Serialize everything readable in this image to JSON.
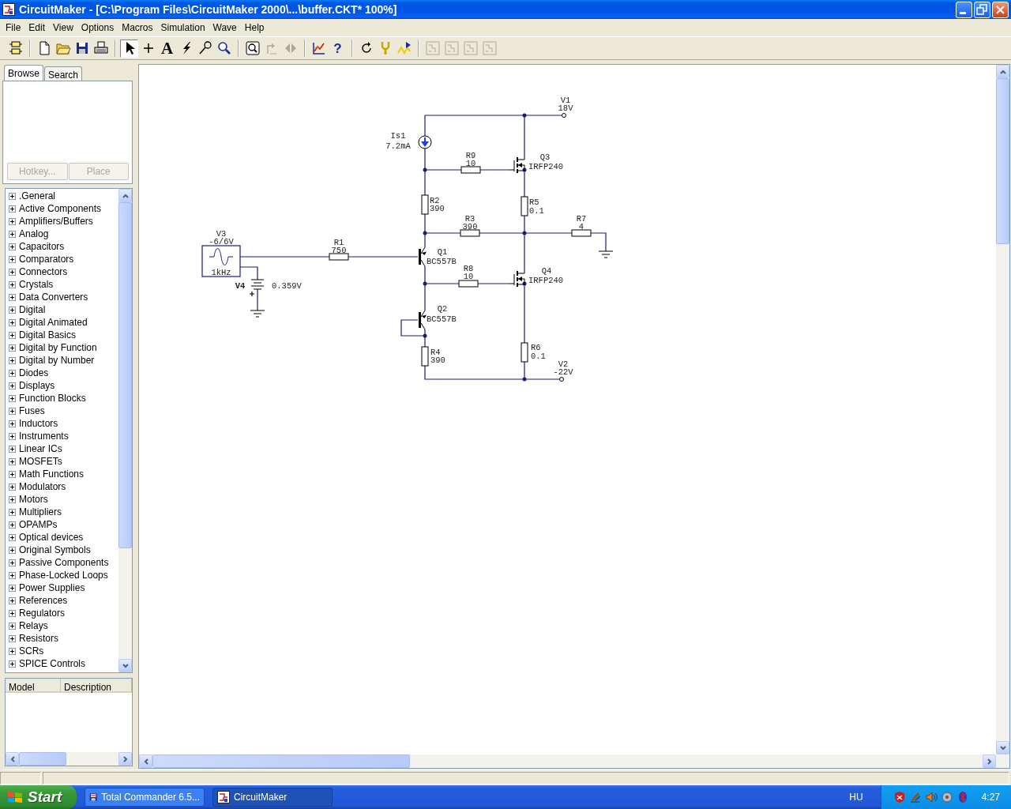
{
  "window": {
    "title": "CircuitMaker - [C:\\Program Files\\CircuitMaker 2000\\...\\buffer.CKT* 100%]"
  },
  "menu": [
    "File",
    "Edit",
    "View",
    "Options",
    "Macros",
    "Simulation",
    "Wave",
    "Help"
  ],
  "toolbar": [
    [
      {
        "kind": "component",
        "selected": false,
        "disabled": false
      }
    ],
    [
      {
        "kind": "new",
        "selected": false,
        "disabled": false
      },
      {
        "kind": "open",
        "selected": false,
        "disabled": false
      },
      {
        "kind": "save",
        "selected": false,
        "disabled": false
      },
      {
        "kind": "print",
        "selected": false,
        "disabled": false
      }
    ],
    [
      {
        "kind": "pointer",
        "selected": true,
        "disabled": false
      },
      {
        "kind": "wire",
        "selected": false,
        "disabled": false
      },
      {
        "kind": "text",
        "label": "A",
        "selected": false,
        "disabled": false
      },
      {
        "kind": "bolt",
        "selected": false,
        "disabled": false
      },
      {
        "kind": "probe",
        "selected": false,
        "disabled": false
      },
      {
        "kind": "zoom",
        "selected": false,
        "disabled": false
      }
    ],
    [
      {
        "kind": "zoom-window",
        "selected": false,
        "disabled": false
      },
      {
        "kind": "rotate",
        "selected": false,
        "disabled": true
      },
      {
        "kind": "mirror",
        "selected": false,
        "disabled": true
      }
    ],
    [
      {
        "kind": "analysis",
        "selected": false,
        "disabled": false
      },
      {
        "kind": "help",
        "label": "?",
        "selected": false,
        "disabled": false
      }
    ],
    [
      {
        "kind": "undo",
        "selected": false,
        "disabled": false
      },
      {
        "kind": "wrench",
        "selected": false,
        "disabled": false
      },
      {
        "kind": "wave",
        "selected": false,
        "disabled": false
      }
    ],
    [
      {
        "kind": "layout",
        "selected": false,
        "disabled": true
      },
      {
        "kind": "layout",
        "selected": false,
        "disabled": true
      },
      {
        "kind": "layout",
        "selected": false,
        "disabled": true
      },
      {
        "kind": "layout",
        "selected": false,
        "disabled": true
      }
    ]
  ],
  "library_panel": {
    "tabs": [
      {
        "label": "Browse",
        "selected": true
      },
      {
        "label": "Search",
        "selected": false
      }
    ],
    "buttons": [
      {
        "label": "Hotkey...",
        "disabled": true
      },
      {
        "label": "Place",
        "disabled": true
      }
    ],
    "categories": [
      {
        "label": ".General",
        "expanded": false
      },
      {
        "label": "Active Components",
        "expanded": false
      },
      {
        "label": "Amplifiers/Buffers",
        "expanded": false
      },
      {
        "label": "Analog",
        "expanded": false
      },
      {
        "label": "Capacitors",
        "expanded": false
      },
      {
        "label": "Comparators",
        "expanded": false
      },
      {
        "label": "Connectors",
        "expanded": false
      },
      {
        "label": "Crystals",
        "expanded": false
      },
      {
        "label": "Data Converters",
        "expanded": false
      },
      {
        "label": "Digital",
        "expanded": false
      },
      {
        "label": "Digital Animated",
        "expanded": false
      },
      {
        "label": "Digital Basics",
        "expanded": false
      },
      {
        "label": "Digital by Function",
        "expanded": false
      },
      {
        "label": "Digital by Number",
        "expanded": false
      },
      {
        "label": "Diodes",
        "expanded": false
      },
      {
        "label": "Displays",
        "expanded": false
      },
      {
        "label": "Function Blocks",
        "expanded": false
      },
      {
        "label": "Fuses",
        "expanded": false
      },
      {
        "label": "Inductors",
        "expanded": false
      },
      {
        "label": "Instruments",
        "expanded": false
      },
      {
        "label": "Linear ICs",
        "expanded": false
      },
      {
        "label": "MOSFETs",
        "expanded": false
      },
      {
        "label": "Math Functions",
        "expanded": false
      },
      {
        "label": "Modulators",
        "expanded": false
      },
      {
        "label": "Motors",
        "expanded": false
      },
      {
        "label": "Multipliers",
        "expanded": false
      },
      {
        "label": "OPAMPs",
        "expanded": false
      },
      {
        "label": "Optical devices",
        "expanded": false
      },
      {
        "label": "Original Symbols",
        "expanded": false
      },
      {
        "label": "Passive Components",
        "expanded": false
      },
      {
        "label": "Phase-Locked Loops",
        "expanded": false
      },
      {
        "label": "Power Supplies",
        "expanded": false
      },
      {
        "label": "References",
        "expanded": false
      },
      {
        "label": "Regulators",
        "expanded": false
      },
      {
        "label": "Relays",
        "expanded": false
      },
      {
        "label": "Resistors",
        "expanded": false
      },
      {
        "label": "SCRs",
        "expanded": false
      },
      {
        "label": "SPICE Controls",
        "expanded": false
      }
    ],
    "columns": [
      "Model",
      "Description"
    ]
  },
  "schematic": {
    "components": [
      {
        "kind": "terminal",
        "designator": "V1",
        "value": "18V"
      },
      {
        "kind": "current-source",
        "designator": "Is1",
        "value": "7.2mA"
      },
      {
        "kind": "resistor",
        "designator": "R9",
        "value": "10"
      },
      {
        "kind": "nmos",
        "designator": "Q3",
        "value": "IRFP240"
      },
      {
        "kind": "resistor",
        "designator": "R2",
        "value": "390"
      },
      {
        "kind": "resistor",
        "designator": "R5",
        "value": "0.1"
      },
      {
        "kind": "resistor",
        "designator": "R3",
        "value": "390"
      },
      {
        "kind": "resistor",
        "designator": "R7",
        "value": "4"
      },
      {
        "kind": "sine-source",
        "designator": "V3",
        "value": "-6/6V",
        "frequency": "1kHz"
      },
      {
        "kind": "resistor",
        "designator": "R1",
        "value": "750"
      },
      {
        "kind": "pnp",
        "designator": "Q1",
        "value": "BC557B"
      },
      {
        "kind": "resistor",
        "designator": "R8",
        "value": "10"
      },
      {
        "kind": "nmos",
        "designator": "Q4",
        "value": "IRFP240"
      },
      {
        "kind": "battery",
        "designator": "V4",
        "value": "0.359V"
      },
      {
        "kind": "pnp",
        "designator": "Q2",
        "value": "BC557B"
      },
      {
        "kind": "resistor",
        "designator": "R4",
        "value": "390"
      },
      {
        "kind": "resistor",
        "designator": "R6",
        "value": "0.1"
      },
      {
        "kind": "terminal",
        "designator": "V2",
        "value": "-22V"
      }
    ]
  },
  "taskbar": {
    "start": "Start",
    "tasks": [
      {
        "label": "Total Commander 6.5...",
        "kind": "disk",
        "selected": false
      },
      {
        "label": "CircuitMaker",
        "kind": "app",
        "selected": true
      }
    ],
    "language": "HU",
    "clock": "4:27"
  }
}
